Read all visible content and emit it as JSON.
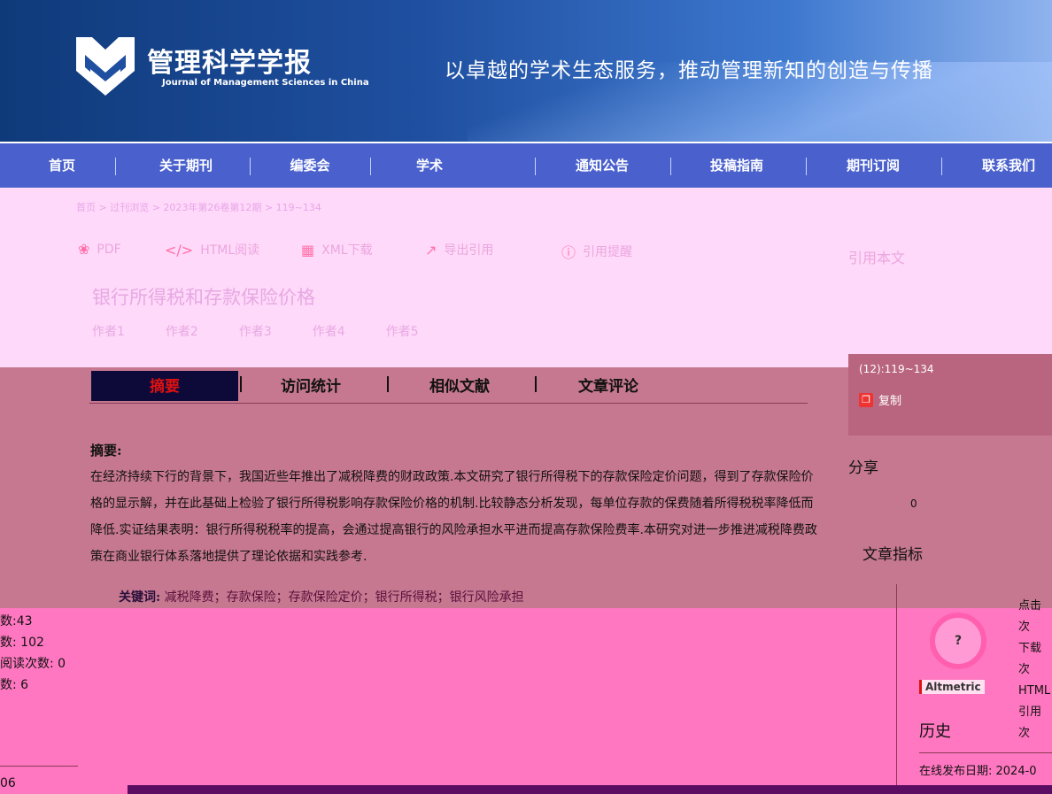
{
  "header": {
    "logo_cn": "管理科学学报",
    "logo_en": "Journal of Management Sciences in China",
    "slogan": "以卓越的学术生态服务，推动管理新知的创造与传播"
  },
  "nav": {
    "items": [
      "首页",
      "关于期刊",
      "编委会",
      "学术",
      "通知公告",
      "投稿指南",
      "期刊订阅",
      "联系我们"
    ]
  },
  "breadcrumb": "首页 > 过刊浏览 > 2023年第26卷第12期 > 119~134",
  "tools": {
    "pdf": "PDF",
    "html": "HTML阅读",
    "xml": "XML下载",
    "export": "导出引用",
    "alert": "引用提醒"
  },
  "article": {
    "title": "银行所得税和存款保险价格",
    "authors": [
      "作者1",
      "作者2",
      "作者3",
      "作者4",
      "作者5"
    ]
  },
  "right_panel": {
    "heading": "引用本文",
    "issue": "(12):119~134",
    "copy_label": "复制"
  },
  "tabs": [
    "摘要",
    "访问统计",
    "相似文献",
    "文章评论"
  ],
  "abstract": {
    "label": "摘要:",
    "text": "在经济持续下行的背景下，我国近些年推出了减税降费的财政政策.本文研究了银行所得税下的存款保险定价问题，得到了存款保险价格的显示解，并在此基础上检验了银行所得税影响存款保险价格的机制.比较静态分析发现，每单位存款的保费随着所得税税率降低而降低.实证结果表明：银行所得税税率的提高，会通过提高银行的风险承担水平进而提高存款保险费率.本研究对进一步推进减税降费政策在商业银行体系落地提供了理论依据和实践参考.",
    "keywords_label": "关键词:",
    "keywords": "减税降费；存款保险；存款保险定价；银行所得税；银行风险承担"
  },
  "share": {
    "label": "分享",
    "count": "0"
  },
  "metrics": {
    "heading": "文章指标"
  },
  "left_stats": [
    "数:43",
    "数: 102",
    "阅读次数: 0",
    "数: 6"
  ],
  "left_bottom": "06",
  "right_stats": [
    "点击次",
    "下载次",
    "HTML",
    "引用次"
  ],
  "badge": {
    "symbol": "?",
    "altmetric": "Altmetric"
  },
  "history": {
    "label": "历史",
    "pub_date": "在线发布日期: 2024-0"
  }
}
